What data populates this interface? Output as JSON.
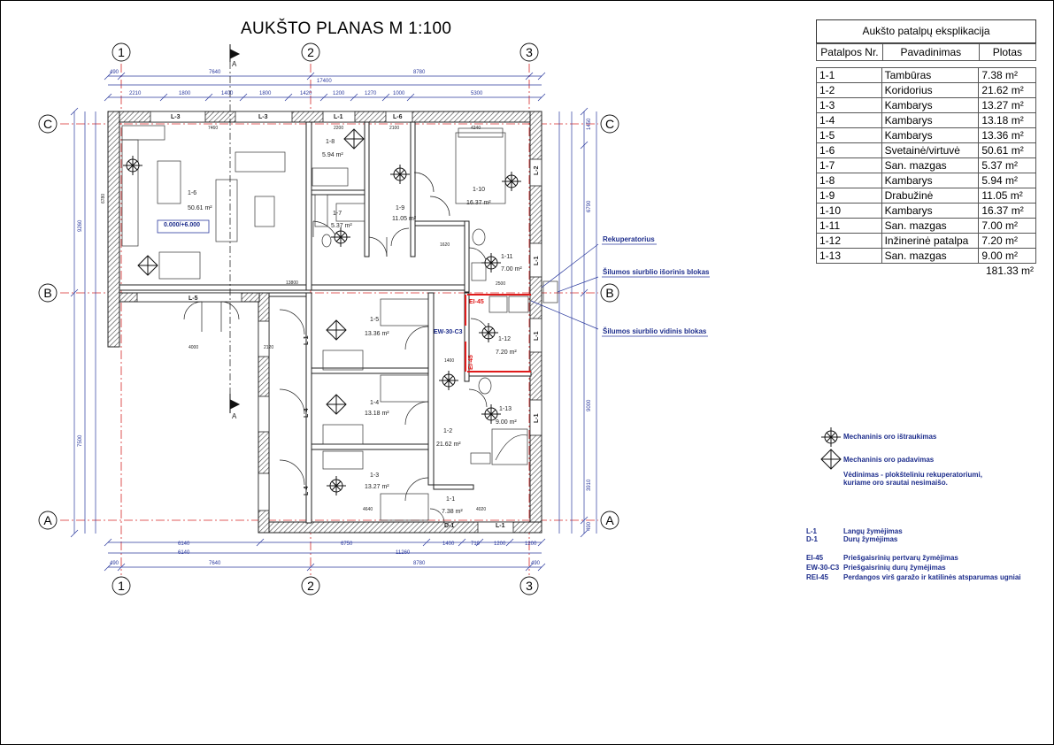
{
  "title": "AUKŠTO PLANAS M  1:100",
  "explication": {
    "caption": "Aukšto patalpų eksplikacija",
    "headers": [
      "Patalpos Nr.",
      "Pavadinimas",
      "Plotas"
    ],
    "rows": [
      {
        "no": "1-1",
        "name": "Tambūras",
        "area": "7.38 m²"
      },
      {
        "no": "1-2",
        "name": "Koridorius",
        "area": "21.62 m²"
      },
      {
        "no": "1-3",
        "name": "Kambarys",
        "area": "13.27 m²"
      },
      {
        "no": "1-4",
        "name": "Kambarys",
        "area": "13.18 m²"
      },
      {
        "no": "1-5",
        "name": "Kambarys",
        "area": "13.36 m²"
      },
      {
        "no": "1-6",
        "name": "Svetainė/virtuvė",
        "area": "50.61 m²"
      },
      {
        "no": "1-7",
        "name": "San. mazgas",
        "area": "5.37 m²"
      },
      {
        "no": "1-8",
        "name": "Kambarys",
        "area": "5.94 m²"
      },
      {
        "no": "1-9",
        "name": "Drabužinė",
        "area": "11.05 m²"
      },
      {
        "no": "1-10",
        "name": "Kambarys",
        "area": "16.37 m²"
      },
      {
        "no": "1-11",
        "name": "San. mazgas",
        "area": "7.00 m²"
      },
      {
        "no": "1-12",
        "name": "Inžinerinė patalpa",
        "area": "7.20 m²"
      },
      {
        "no": "1-13",
        "name": "San. mazgas",
        "area": "9.00 m²"
      }
    ],
    "total": "181.33 m²"
  },
  "axes": {
    "cols": [
      "1",
      "2",
      "3"
    ],
    "rows": [
      "C",
      "B",
      "A"
    ]
  },
  "section_mark": "A",
  "level_mark": "0.000/+6.000",
  "dims_top1": [
    "490",
    "7640",
    "8780"
  ],
  "dims_top2": [
    "17400"
  ],
  "dims_top3": [
    "2210",
    "1800",
    "1400",
    "1800",
    "1420",
    "1200",
    "1270",
    "1000",
    "5300"
  ],
  "dims_bottom1": [
    "6140",
    "6750",
    "1400",
    "710",
    "1200",
    "1200"
  ],
  "dims_bottom2": [
    "6140",
    "11260"
  ],
  "dims_bottom3": [
    "490",
    "7640",
    "8780",
    "490"
  ],
  "dims_left": [
    "9260",
    "7500"
  ],
  "dims_right": [
    "1450",
    "6790",
    "9000",
    "3910",
    "490"
  ],
  "window_tags": [
    "L-3",
    "L-3",
    "L-1",
    "L-6",
    "L-5",
    "L-2",
    "L-1",
    "L-1",
    "L-1",
    "L-1",
    "L-4",
    "L-4",
    "L-4",
    "L-1",
    "D-1"
  ],
  "fire_tags": [
    "EI-45",
    "EW-30-C3",
    "EI-45"
  ],
  "rooms": [
    {
      "no": "1-6",
      "area": "50.61 m²"
    },
    {
      "no": "1-8",
      "area": "5.94 m²"
    },
    {
      "no": "1-7",
      "area": "5.37 m²"
    },
    {
      "no": "1-9",
      "area": "11.05 m²"
    },
    {
      "no": "1-10",
      "area": "16.37 m²"
    },
    {
      "no": "1-11",
      "area": "7.00 m²"
    },
    {
      "no": "1-5",
      "area": "13.36 m²"
    },
    {
      "no": "1-12",
      "area": "7.20 m²"
    },
    {
      "no": "1-4",
      "area": "13.18 m²"
    },
    {
      "no": "1-13",
      "area": "9.00 m²"
    },
    {
      "no": "1-2",
      "area": "21.62 m²"
    },
    {
      "no": "1-3",
      "area": "13.27 m²"
    },
    {
      "no": "1-1",
      "area": "7.38 m²"
    }
  ],
  "inner_dims": [
    "7460",
    "2200",
    "2100",
    "4240",
    "13800",
    "1620",
    "2500",
    "4000",
    "2120",
    "1400",
    "4640",
    "4020",
    "6780"
  ],
  "callouts": {
    "recuperator": "Rekuperatorius",
    "hp_outer": "Šilumos siurblio išorinis blokas",
    "hp_inner": "Šilumos siurblio vidinis blokas"
  },
  "ventilation_legend": {
    "exhaust": "Mechaninis oro ištraukimas",
    "supply": "Mechaninis oro padavimas",
    "note1": "Vėdinimas - plokšteliniu rekuperatoriumi,",
    "note2": "kuriame oro srautai nesimaišo."
  },
  "marking_legend": [
    {
      "k": "L-1",
      "v": "Langų žymėjimas"
    },
    {
      "k": "D-1",
      "v": "Durų žymėjimas"
    },
    {
      "k": "EI-45",
      "v": "Priešgaisrinių pertvarų žymėjimas"
    },
    {
      "k": "EW-30-C3",
      "v": "Priešgaisrinių durų žymėjimas"
    },
    {
      "k": "REI-45",
      "v": "Perdangos virš garažo ir katilinės  atsparumas ugniai"
    }
  ],
  "colors": {
    "axis": "#d62828",
    "dim": "#2b3a9e",
    "wall": "#222222",
    "hatch": "#555555",
    "fire": "#e01b1b",
    "text_blue": "#1d2d8c"
  }
}
